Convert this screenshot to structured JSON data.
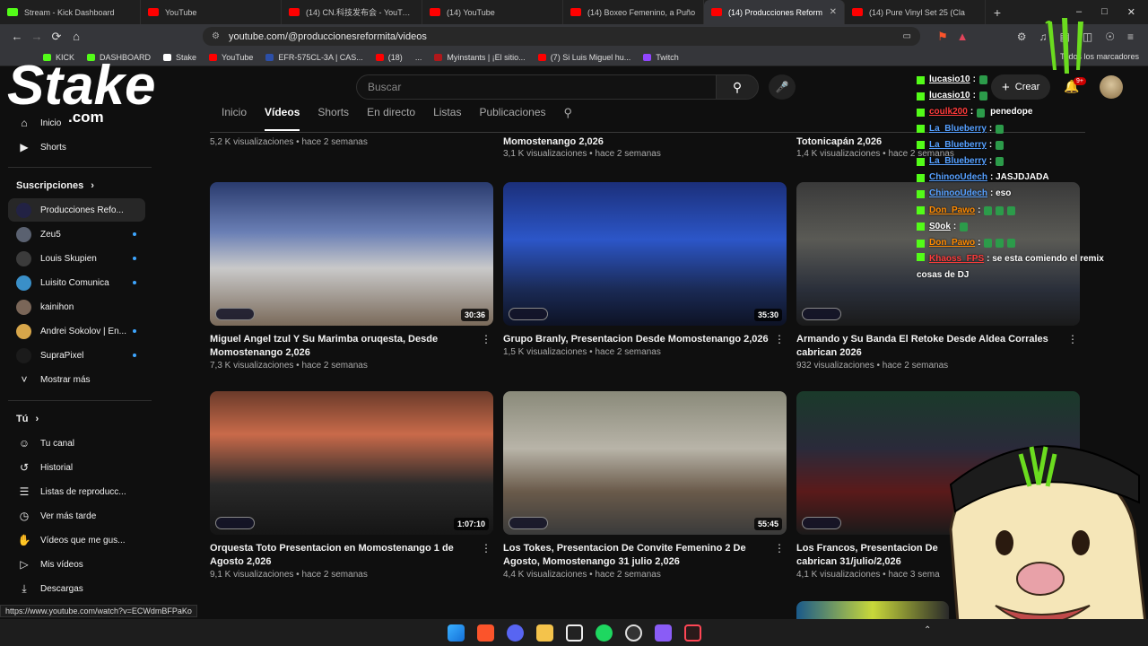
{
  "browser": {
    "tabs": [
      {
        "label": "Stream - Kick Dashboard",
        "favicon": "kick",
        "active": false
      },
      {
        "label": "YouTube",
        "favicon": "youtube",
        "active": false
      },
      {
        "label": "(14) CN.科技发布会 - YouTube",
        "favicon": "youtube",
        "active": false
      },
      {
        "label": "(14) YouTube",
        "favicon": "youtube",
        "active": false
      },
      {
        "label": "(14) Boxeo Femenino, a Puño",
        "favicon": "youtube",
        "active": false
      },
      {
        "label": "(14) Producciones Reform",
        "favicon": "youtube",
        "active": true
      },
      {
        "label": "(14) Pure Vinyl Set 25 (Cla",
        "favicon": "youtube",
        "active": false
      }
    ],
    "url": "youtube.com/@produccionesreformita/videos",
    "bookmarks": [
      {
        "label": "KICK",
        "color": "#53fc18"
      },
      {
        "label": "DASHBOARD",
        "color": "#53fc18"
      },
      {
        "label": "Stake",
        "color": "#ffffff"
      },
      {
        "label": "YouTube",
        "color": "#ff0000"
      },
      {
        "label": "EFR-575CL-3A | CAS...",
        "color": "#2c4fa8"
      },
      {
        "label": "(18)",
        "color": "#ff0000"
      },
      {
        "label": "...",
        "color": ""
      },
      {
        "label": "Myinstants | ¡El sitio...",
        "color": "#b0181b"
      },
      {
        "label": "(7) Si Luis Miguel hu...",
        "color": "#ff0000"
      },
      {
        "label": "Twitch",
        "color": "#9146ff"
      }
    ],
    "bookmarks_right": "Todos los marcadores",
    "status_url": "https://www.youtube.com/watch?v=ECWdmBFPaKo"
  },
  "youtube": {
    "search_placeholder": "Buscar",
    "create_label": "Crear",
    "notif_count": "9+",
    "channel_tabs": [
      "Inicio",
      "Vídeos",
      "Shorts",
      "En directo",
      "Listas",
      "Publicaciones"
    ],
    "active_tab": "Vídeos"
  },
  "sidebar": {
    "top": [
      {
        "label": "Inicio",
        "icon": "home-icon"
      },
      {
        "label": "Shorts",
        "icon": "shorts-icon"
      }
    ],
    "subs_heading": "Suscripciones",
    "subscriptions": [
      {
        "label": "Producciones Refo...",
        "color": "#222244",
        "dot": false
      },
      {
        "label": "Zeu5",
        "color": "#5a6170",
        "dot": true
      },
      {
        "label": "Louis Skupien",
        "color": "#3b3b3b",
        "dot": true
      },
      {
        "label": "Luisito Comunica",
        "color": "#3a8fc8",
        "dot": true
      },
      {
        "label": "kainihon",
        "color": "#7a6658",
        "dot": false
      },
      {
        "label": "Andrei Sokolov | En...",
        "color": "#d7a64a",
        "dot": true
      },
      {
        "label": "SupraPixel",
        "color": "#1b1b1b",
        "dot": true
      }
    ],
    "show_more": "Mostrar más",
    "you_heading": "Tú",
    "you_items": [
      {
        "label": "Tu canal",
        "icon": "account-icon"
      },
      {
        "label": "Historial",
        "icon": "history-icon"
      },
      {
        "label": "Listas de reproducc...",
        "icon": "playlist-icon"
      },
      {
        "label": "Ver más tarde",
        "icon": "clock-icon"
      },
      {
        "label": "Vídeos que me gus...",
        "icon": "like-icon"
      },
      {
        "label": "Mis vídeos",
        "icon": "my-videos-icon"
      },
      {
        "label": "Descargas",
        "icon": "download-icon"
      }
    ]
  },
  "partial_row": [
    {
      "title": "",
      "meta": "5,2 K visualizaciones • hace 2 semanas"
    },
    {
      "title": "Momostenango 2,026",
      "meta": "3,1 K visualizaciones • hace 2 semanas"
    },
    {
      "title": "Totonicapán 2,026",
      "meta": "1,4 K visualizaciones • hace 2 semanas"
    }
  ],
  "videos": [
    {
      "title": "Miguel Angel tzul Y Su Marimba oruqesta, Desde Momostenango 2,026",
      "meta": "7,3 K visualizaciones • hace 2 semanas",
      "duration": "30:36"
    },
    {
      "title": "Grupo Branly, Presentacion Desde  Momostenango 2,026",
      "meta": "1,5 K visualizaciones • hace 2 semanas",
      "duration": "35:30"
    },
    {
      "title": "Armando y Su Banda El Retoke Desde Aldea Corrales cabrican 2026",
      "meta": "932 visualizaciones • hace 2 semanas",
      "duration": ""
    },
    {
      "title": "Orquesta Toto Presentacion en Momostenango 1 de Agosto 2,026",
      "meta": "9,1 K visualizaciones • hace 2 semanas",
      "duration": "1:07:10"
    },
    {
      "title": "Los Tokes, Presentacion De Convite Femenino 2 De Agosto, Momostenango 31 julio 2,026",
      "meta": "4,4 K visualizaciones • hace 2 semanas",
      "duration": "55:45"
    },
    {
      "title": "Los Francos, Presentacion De",
      "title2": "cabrican 31/julio/2,026",
      "meta": "4,1 K visualizaciones • hace 3 sema",
      "duration": ""
    }
  ],
  "chat": [
    {
      "user": "lucasio10",
      "color": "#ffffff",
      "msg": ":",
      "emotes": 1
    },
    {
      "user": "lucasio10",
      "color": "#ffffff",
      "msg": ":",
      "emotes": 1
    },
    {
      "user": "coulk200",
      "color": "#ff3b3b",
      "msg": ":",
      "emotes": 1,
      "extra": "penedope"
    },
    {
      "user": "La_Blueberry",
      "color": "#56a0ff",
      "msg": ":",
      "emotes": 1
    },
    {
      "user": "La_Blueberry",
      "color": "#56a0ff",
      "msg": ":",
      "emotes": 1
    },
    {
      "user": "La_Blueberry",
      "color": "#56a0ff",
      "msg": ":",
      "emotes": 1
    },
    {
      "user": "ChinooUdech",
      "color": "#56a0ff",
      "msg": ": JASJDJADA",
      "emotes": 0
    },
    {
      "user": "ChinooUdech",
      "color": "#56a0ff",
      "msg": ": eso",
      "emotes": 0
    },
    {
      "user": "Don_Pawo",
      "color": "#ff8a00",
      "msg": ":",
      "emotes": 3
    },
    {
      "user": "S0ok",
      "color": "#ffffff",
      "msg": ":",
      "emotes": 1
    },
    {
      "user": "Don_Pawo",
      "color": "#ff8a00",
      "msg": ":",
      "emotes": 3
    },
    {
      "user": "Khaoss_FPS",
      "color": "#ff3b3b",
      "msg": ": se esta comiendo el remix",
      "msg2": "cosas de DJ",
      "emotes": 0
    }
  ],
  "overlays": {
    "stake_text": "Stake",
    "stake_sub": ".com"
  }
}
